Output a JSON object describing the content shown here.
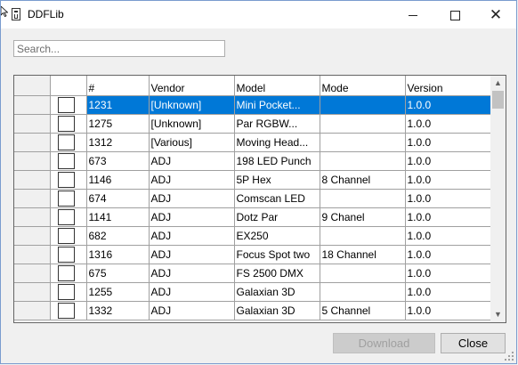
{
  "window": {
    "title": "DDFLib"
  },
  "search": {
    "placeholder": "Search...",
    "value": ""
  },
  "table": {
    "columns": [
      "#",
      "Vendor",
      "Model",
      "Mode",
      "Version"
    ],
    "rows": [
      {
        "num": "1231",
        "vendor": "[Unknown]",
        "model": "Mini Pocket...",
        "mode": "",
        "version": "1.0.0",
        "selected": true
      },
      {
        "num": "1275",
        "vendor": "[Unknown]",
        "model": "Par RGBW...",
        "mode": "",
        "version": "1.0.0"
      },
      {
        "num": "1312",
        "vendor": "[Various]",
        "model": "Moving Head...",
        "mode": "",
        "version": "1.0.0"
      },
      {
        "num": "673",
        "vendor": "ADJ",
        "model": "198 LED Punch",
        "mode": "",
        "version": "1.0.0"
      },
      {
        "num": "1146",
        "vendor": "ADJ",
        "model": "5P Hex",
        "mode": "8 Channel",
        "version": "1.0.0"
      },
      {
        "num": "674",
        "vendor": "ADJ",
        "model": "Comscan LED",
        "mode": "",
        "version": "1.0.0"
      },
      {
        "num": "1141",
        "vendor": "ADJ",
        "model": "Dotz Par",
        "mode": "9 Chanel",
        "version": "1.0.0"
      },
      {
        "num": "682",
        "vendor": "ADJ",
        "model": "EX250",
        "mode": "",
        "version": "1.0.0"
      },
      {
        "num": "1316",
        "vendor": "ADJ",
        "model": "Focus Spot two",
        "mode": "18 Channel",
        "version": "1.0.0"
      },
      {
        "num": "675",
        "vendor": "ADJ",
        "model": "FS 2500 DMX",
        "mode": "",
        "version": "1.0.0"
      },
      {
        "num": "1255",
        "vendor": "ADJ",
        "model": "Galaxian 3D",
        "mode": "",
        "version": "1.0.0"
      },
      {
        "num": "1332",
        "vendor": "ADJ",
        "model": "Galaxian 3D",
        "mode": "5 Channel",
        "version": "1.0.0"
      }
    ]
  },
  "buttons": {
    "download": "Download",
    "close": "Close"
  },
  "colors": {
    "selection": "#0078d7",
    "accent_border": "#7a9ccf"
  },
  "icons": {
    "app": "ddf-file-icon",
    "minimize": "minimize-icon",
    "maximize": "maximize-icon",
    "close": "close-icon"
  }
}
